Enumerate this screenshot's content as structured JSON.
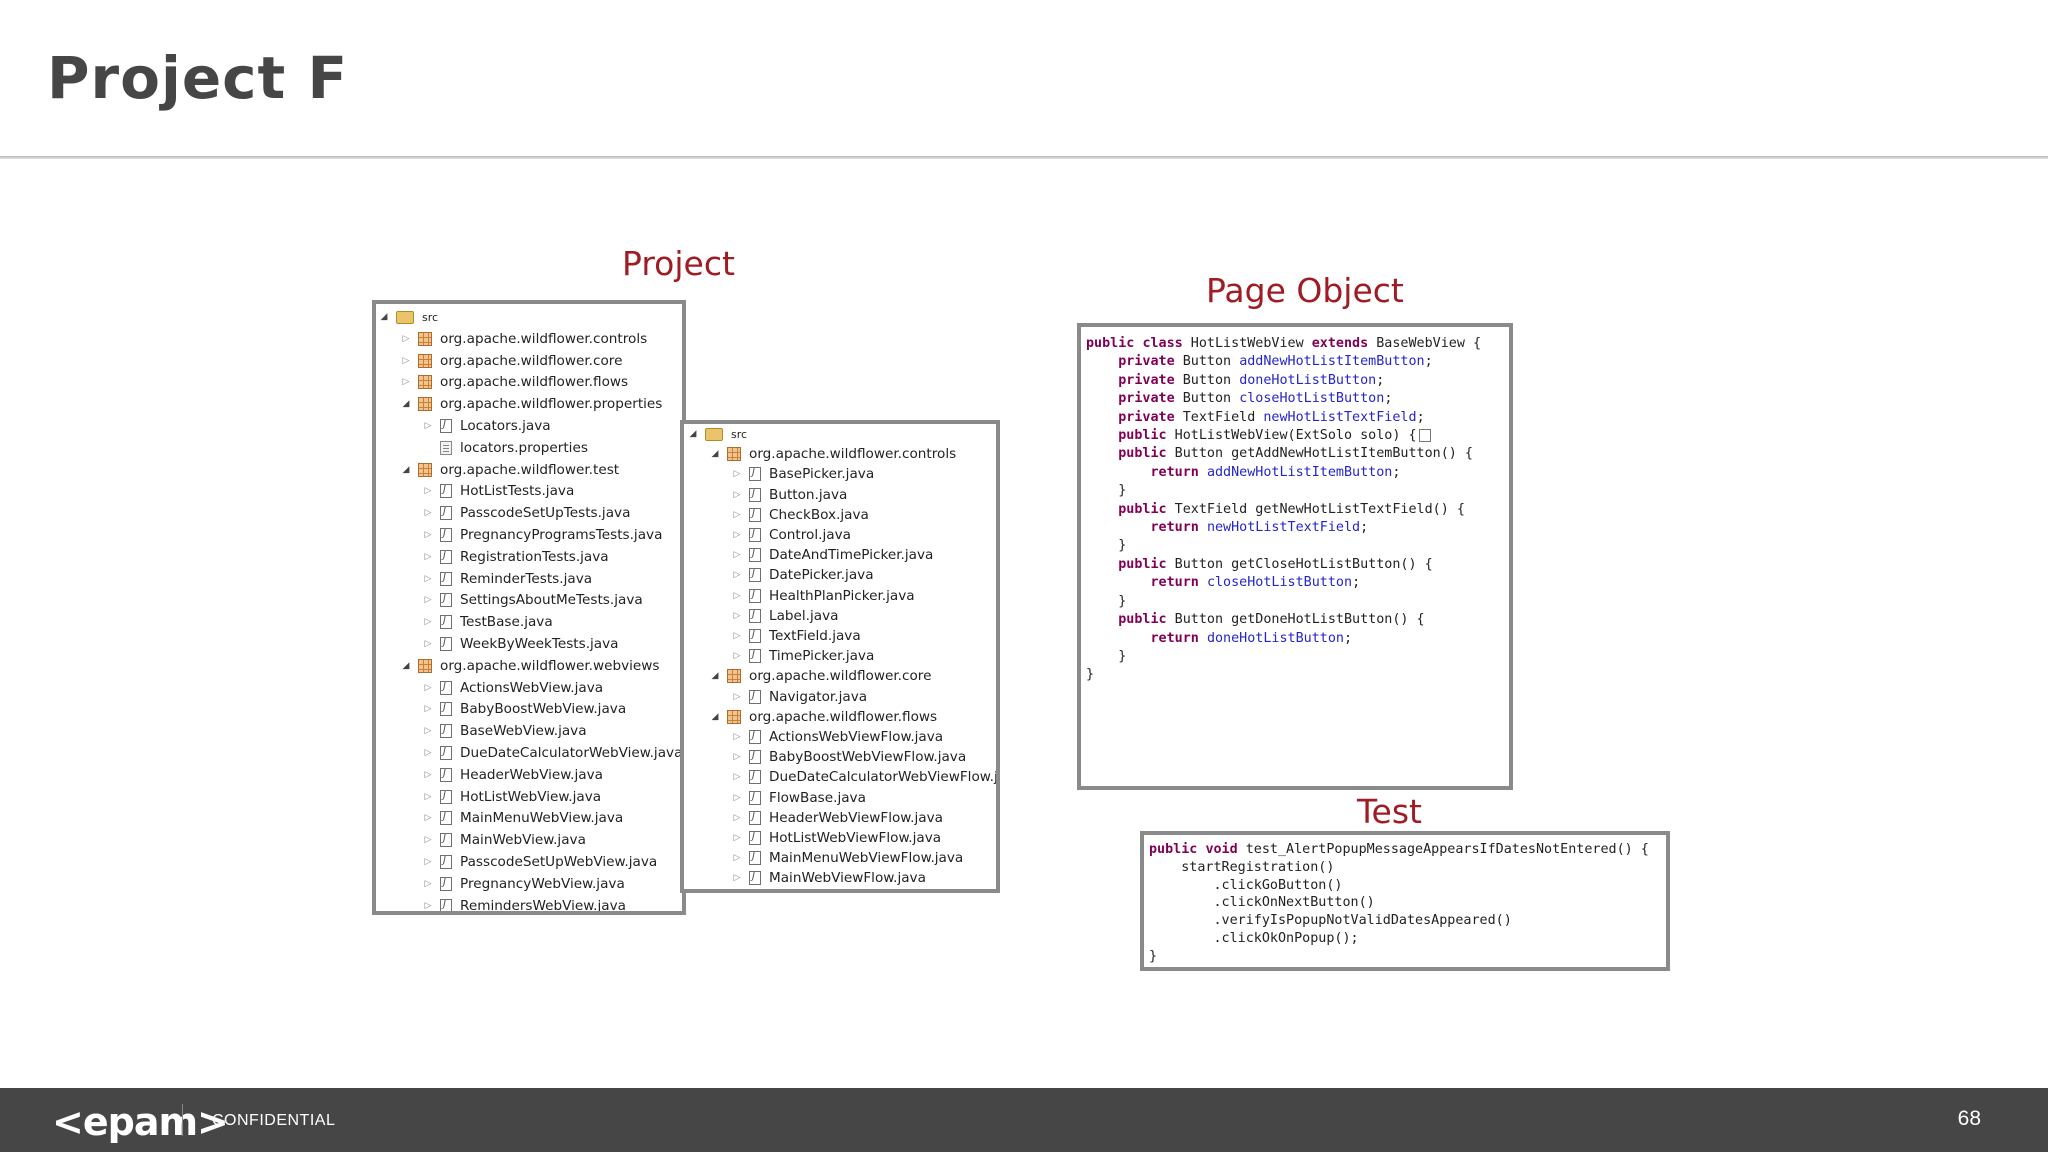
{
  "slide": {
    "title": "Project F",
    "page_number": "68"
  },
  "labels": {
    "project": "Project",
    "page_object": "Page Object",
    "test": "Test"
  },
  "footer": {
    "logo": "<epam>",
    "confidential": "CONFIDENTIAL"
  },
  "tree1": [
    {
      "label": "src",
      "level": 0,
      "icon": "folder",
      "state": "open"
    },
    {
      "label": "org.apache.wildflower.controls",
      "level": 1,
      "icon": "package",
      "state": "closed"
    },
    {
      "label": "org.apache.wildflower.core",
      "level": 1,
      "icon": "package",
      "state": "closed"
    },
    {
      "label": "org.apache.wildflower.flows",
      "level": 1,
      "icon": "package",
      "state": "closed"
    },
    {
      "label": "org.apache.wildflower.properties",
      "level": 1,
      "icon": "package",
      "state": "open"
    },
    {
      "label": "Locators.java",
      "level": 2,
      "icon": "java-file",
      "state": "closed"
    },
    {
      "label": "locators.properties",
      "level": 2,
      "icon": "properties-file",
      "state": "none"
    },
    {
      "label": "org.apache.wildflower.test",
      "level": 1,
      "icon": "package",
      "state": "open"
    },
    {
      "label": "HotListTests.java",
      "level": 2,
      "icon": "java-file",
      "state": "closed"
    },
    {
      "label": "PasscodeSetUpTests.java",
      "level": 2,
      "icon": "java-file",
      "state": "closed"
    },
    {
      "label": "PregnancyProgramsTests.java",
      "level": 2,
      "icon": "java-file",
      "state": "closed"
    },
    {
      "label": "RegistrationTests.java",
      "level": 2,
      "icon": "java-file",
      "state": "closed"
    },
    {
      "label": "ReminderTests.java",
      "level": 2,
      "icon": "java-file",
      "state": "closed"
    },
    {
      "label": "SettingsAboutMeTests.java",
      "level": 2,
      "icon": "java-file",
      "state": "closed"
    },
    {
      "label": "TestBase.java",
      "level": 2,
      "icon": "java-file",
      "state": "closed"
    },
    {
      "label": "WeekByWeekTests.java",
      "level": 2,
      "icon": "java-file",
      "state": "closed"
    },
    {
      "label": "org.apache.wildflower.webviews",
      "level": 1,
      "icon": "package",
      "state": "open"
    },
    {
      "label": "ActionsWebView.java",
      "level": 2,
      "icon": "java-file",
      "state": "closed"
    },
    {
      "label": "BabyBoostWebView.java",
      "level": 2,
      "icon": "java-file",
      "state": "closed"
    },
    {
      "label": "BaseWebView.java",
      "level": 2,
      "icon": "java-file",
      "state": "closed"
    },
    {
      "label": "DueDateCalculatorWebView.java",
      "level": 2,
      "icon": "java-file",
      "state": "closed"
    },
    {
      "label": "HeaderWebView.java",
      "level": 2,
      "icon": "java-file",
      "state": "closed"
    },
    {
      "label": "HotListWebView.java",
      "level": 2,
      "icon": "java-file",
      "state": "closed"
    },
    {
      "label": "MainMenuWebView.java",
      "level": 2,
      "icon": "java-file",
      "state": "closed"
    },
    {
      "label": "MainWebView.java",
      "level": 2,
      "icon": "java-file",
      "state": "closed"
    },
    {
      "label": "PasscodeSetUpWebView.java",
      "level": 2,
      "icon": "java-file",
      "state": "closed"
    },
    {
      "label": "PregnancyWebView.java",
      "level": 2,
      "icon": "java-file",
      "state": "closed"
    },
    {
      "label": "RemindersWebView.java",
      "level": 2,
      "icon": "java-file",
      "state": "closed"
    }
  ],
  "tree2": [
    {
      "label": "src",
      "level": 0,
      "icon": "folder",
      "state": "open"
    },
    {
      "label": "org.apache.wildflower.controls",
      "level": 1,
      "icon": "package",
      "state": "open"
    },
    {
      "label": "BasePicker.java",
      "level": 2,
      "icon": "java-file",
      "state": "closed"
    },
    {
      "label": "Button.java",
      "level": 2,
      "icon": "java-file",
      "state": "closed"
    },
    {
      "label": "CheckBox.java",
      "level": 2,
      "icon": "java-file",
      "state": "closed"
    },
    {
      "label": "Control.java",
      "level": 2,
      "icon": "java-file",
      "state": "closed"
    },
    {
      "label": "DateAndTimePicker.java",
      "level": 2,
      "icon": "java-file",
      "state": "closed"
    },
    {
      "label": "DatePicker.java",
      "level": 2,
      "icon": "java-file",
      "state": "closed"
    },
    {
      "label": "HealthPlanPicker.java",
      "level": 2,
      "icon": "java-file",
      "state": "closed"
    },
    {
      "label": "Label.java",
      "level": 2,
      "icon": "java-file",
      "state": "closed"
    },
    {
      "label": "TextField.java",
      "level": 2,
      "icon": "java-file",
      "state": "closed"
    },
    {
      "label": "TimePicker.java",
      "level": 2,
      "icon": "java-file",
      "state": "closed"
    },
    {
      "label": "org.apache.wildflower.core",
      "level": 1,
      "icon": "package",
      "state": "open"
    },
    {
      "label": "Navigator.java",
      "level": 2,
      "icon": "java-file",
      "state": "closed"
    },
    {
      "label": "org.apache.wildflower.flows",
      "level": 1,
      "icon": "package",
      "state": "open"
    },
    {
      "label": "ActionsWebViewFlow.java",
      "level": 2,
      "icon": "java-file",
      "state": "closed"
    },
    {
      "label": "BabyBoostWebViewFlow.java",
      "level": 2,
      "icon": "java-file",
      "state": "closed"
    },
    {
      "label": "DueDateCalculatorWebViewFlow.java",
      "level": 2,
      "icon": "java-file",
      "state": "closed"
    },
    {
      "label": "FlowBase.java",
      "level": 2,
      "icon": "java-file",
      "state": "closed"
    },
    {
      "label": "HeaderWebViewFlow.java",
      "level": 2,
      "icon": "java-file",
      "state": "closed"
    },
    {
      "label": "HotListWebViewFlow.java",
      "level": 2,
      "icon": "java-file",
      "state": "closed"
    },
    {
      "label": "MainMenuWebViewFlow.java",
      "level": 2,
      "icon": "java-file",
      "state": "closed"
    },
    {
      "label": "MainWebViewFlow.java",
      "level": 2,
      "icon": "java-file",
      "state": "closed"
    }
  ],
  "page_object_code": [
    "public class HotListWebView extends BaseWebView {",
    "    private Button addNewHotListItemButton;",
    "    private Button doneHotListButton;",
    "    private Button closeHotListButton;",
    "    private TextField newHotListTextField;",
    "",
    "    public HotListWebView(ExtSolo solo) {",
    "",
    "    public Button getAddNewHotListItemButton() {",
    "        return addNewHotListItemButton;",
    "    }",
    "",
    "    public TextField getNewHotListTextField() {",
    "        return newHotListTextField;",
    "    }",
    "",
    "    public Button getCloseHotListButton() {",
    "        return closeHotListButton;",
    "    }",
    "",
    "    public Button getDoneHotListButton() {",
    "        return doneHotListButton;",
    "    }",
    "}"
  ],
  "test_code": [
    "public void test_AlertPopupMessageAppearsIfDatesNotEntered() {",
    "    startRegistration()",
    "        .clickGoButton()",
    "        .clickOnNextButton()",
    "        .verifyIsPopupNotValidDatesAppeared()",
    "        .clickOkOnPopup();",
    "}"
  ]
}
